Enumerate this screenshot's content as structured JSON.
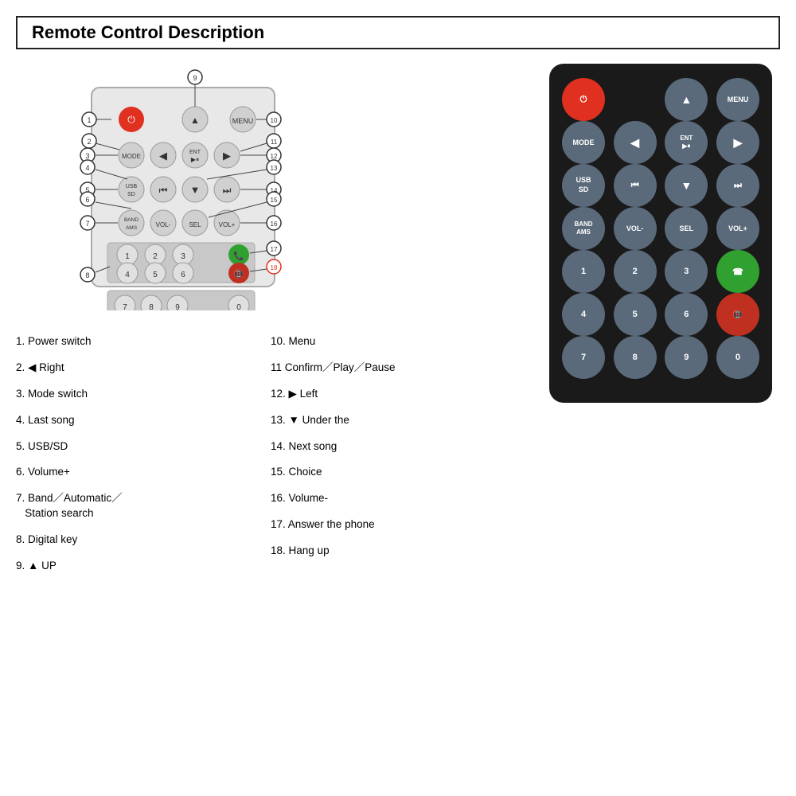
{
  "title": "Remote Control Description",
  "diagram": {
    "callouts": [
      {
        "num": "1",
        "label": "Power switch"
      },
      {
        "num": "2",
        "label": "◀ Right"
      },
      {
        "num": "3",
        "label": "Mode switch"
      },
      {
        "num": "4",
        "label": "Last song"
      },
      {
        "num": "5",
        "label": "USB/SD"
      },
      {
        "num": "6",
        "label": "Volume+"
      },
      {
        "num": "7",
        "label": "Band／Automatic／Station search"
      },
      {
        "num": "8",
        "label": "Digital key"
      },
      {
        "num": "9",
        "label": "▲ UP"
      },
      {
        "num": "10",
        "label": "Menu"
      },
      {
        "num": "11",
        "label": "Confirm／Play／Pause"
      },
      {
        "num": "12",
        "label": "▶ Left"
      },
      {
        "num": "13",
        "label": "▼ Under the"
      },
      {
        "num": "14",
        "label": "Next song"
      },
      {
        "num": "15",
        "label": "Choice"
      },
      {
        "num": "16",
        "label": "Volume-"
      },
      {
        "num": "17",
        "label": "Answer the phone"
      },
      {
        "num": "18",
        "label": "Hang up"
      }
    ]
  },
  "remote": {
    "rows": [
      [
        {
          "label": "⏻",
          "type": "power",
          "name": "power-btn"
        },
        {
          "label": "",
          "type": "spacer"
        },
        {
          "label": "▲",
          "type": "arrow",
          "name": "up-btn"
        },
        {
          "label": "MENU",
          "type": "normal",
          "name": "menu-btn"
        }
      ],
      [
        {
          "label": "MODE",
          "type": "small-label",
          "name": "mode-btn"
        },
        {
          "label": "◀",
          "type": "arrow",
          "name": "left-btn"
        },
        {
          "label": "ENT\n▶⏸",
          "type": "small-label",
          "name": "ent-btn"
        },
        {
          "label": "▶",
          "type": "arrow",
          "name": "right-btn"
        }
      ],
      [
        {
          "label": "USB\nSD",
          "type": "small-label",
          "name": "usb-btn"
        },
        {
          "label": "⏮",
          "type": "normal",
          "name": "prev-btn"
        },
        {
          "label": "▼",
          "type": "arrow",
          "name": "down-btn"
        },
        {
          "label": "⏭",
          "type": "normal",
          "name": "next-btn"
        }
      ],
      [
        {
          "label": "BAND\nAMS",
          "type": "small-label",
          "name": "band-btn"
        },
        {
          "label": "VOL-",
          "type": "small-label",
          "name": "vol-minus-btn"
        },
        {
          "label": "SEL",
          "type": "small-label",
          "name": "sel-btn"
        },
        {
          "label": "VOL+",
          "type": "small-label",
          "name": "vol-plus-btn"
        }
      ],
      [
        {
          "label": "1",
          "type": "normal",
          "name": "num1-btn"
        },
        {
          "label": "2",
          "type": "normal",
          "name": "num2-btn"
        },
        {
          "label": "3",
          "type": "normal",
          "name": "num3-btn"
        },
        {
          "label": "📞",
          "type": "green-call",
          "name": "answer-btn"
        }
      ],
      [
        {
          "label": "4",
          "type": "normal",
          "name": "num4-btn"
        },
        {
          "label": "5",
          "type": "normal",
          "name": "num5-btn"
        },
        {
          "label": "6",
          "type": "normal",
          "name": "num6-btn"
        },
        {
          "label": "📵",
          "type": "red-call",
          "name": "hangup-btn"
        }
      ],
      [
        {
          "label": "7",
          "type": "normal",
          "name": "num7-btn"
        },
        {
          "label": "8",
          "type": "normal",
          "name": "num8-btn"
        },
        {
          "label": "9",
          "type": "normal",
          "name": "num9-btn"
        },
        {
          "label": "0",
          "type": "normal",
          "name": "num0-btn"
        }
      ]
    ]
  },
  "descriptions_left": [
    {
      "num": "1",
      "text": "Power switch"
    },
    {
      "num": "2",
      "text": "◀ Right"
    },
    {
      "num": "3",
      "text": "Mode switch"
    },
    {
      "num": "4",
      "text": "Last song"
    },
    {
      "num": "5",
      "text": "USB/SD"
    },
    {
      "num": "6",
      "text": "Volume+"
    },
    {
      "num": "7",
      "text": "Band／Automatic／\n  Station search"
    },
    {
      "num": "8",
      "text": "Digital key"
    },
    {
      "num": "9",
      "text": "▲ UP"
    }
  ],
  "descriptions_right": [
    {
      "num": "10",
      "text": "Menu"
    },
    {
      "num": "11",
      "text": "Confirm／Play／Pause"
    },
    {
      "num": "12",
      "text": "▶ Left"
    },
    {
      "num": "13",
      "text": "▼ Under the"
    },
    {
      "num": "14",
      "text": "Next song"
    },
    {
      "num": "15",
      "text": "Choice"
    },
    {
      "num": "16",
      "text": "Volume-"
    },
    {
      "num": "17",
      "text": "Answer the phone"
    },
    {
      "num": "18",
      "text": "Hang up"
    }
  ]
}
